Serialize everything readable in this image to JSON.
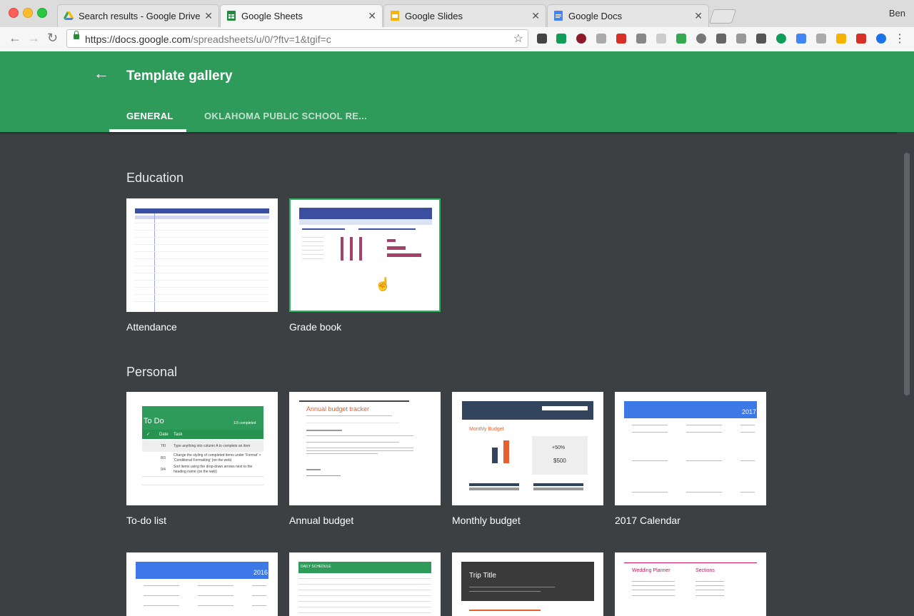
{
  "browser": {
    "tabs": [
      {
        "title": "Search results - Google Drive",
        "icon": "google-drive-icon"
      },
      {
        "title": "Google Sheets",
        "icon": "google-sheets-icon",
        "active": true
      },
      {
        "title": "Google Slides",
        "icon": "google-slides-icon"
      },
      {
        "title": "Google Docs",
        "icon": "google-docs-icon"
      }
    ],
    "user": "Ben",
    "url_host": "https://docs.google.com",
    "url_path": "/spreadsheets/u/0/?ftv=1&tgif=c"
  },
  "header": {
    "title": "Template gallery",
    "tabs": [
      "GENERAL",
      "OKLAHOMA PUBLIC SCHOOL RE..."
    ],
    "color": "#2e9b5b"
  },
  "sections": [
    {
      "title": "Education",
      "templates": [
        "Attendance",
        "Grade book"
      ]
    },
    {
      "title": "Personal",
      "templates": [
        "To-do list",
        "Annual budget",
        "Monthly budget",
        "2017 Calendar"
      ]
    }
  ],
  "thumbs": {
    "todo": {
      "title": "To Do",
      "completed": "1/3 completed",
      "col_date": "Date",
      "col_task": "Task",
      "rows": [
        {
          "date": "7/0",
          "task": "Type anything into column A to complete an item"
        },
        {
          "date": "8/3",
          "task": "Change the styling of completed items under 'Format' > 'Conditional Formatting' (on the web)"
        },
        {
          "date": "9/4",
          "task": "Sort items using the drop-down arrows next to the heading name (on the web)"
        }
      ]
    },
    "annual": {
      "title": "Annual budget tracker"
    },
    "monthly": {
      "title": "Monthly Budget",
      "pct": "+50%",
      "amount": "$500"
    },
    "calendar": {
      "year": "2017"
    },
    "calendar2016": {
      "year": "2016"
    },
    "daily": {
      "title": "DAILY SCHEDULE"
    },
    "trip": {
      "title": "Trip Title"
    },
    "wedding": {
      "title": "Wedding Planner",
      "sections": "Sections"
    }
  }
}
